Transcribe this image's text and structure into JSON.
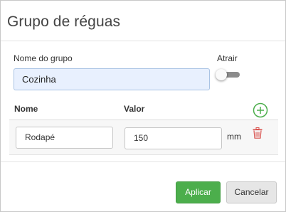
{
  "dialog": {
    "title": "Grupo de réguas"
  },
  "group": {
    "name_label": "Nome do grupo",
    "name_value": "Cozinha",
    "attract_label": "Atrair",
    "attract_enabled": false
  },
  "table": {
    "columns": [
      "Nome",
      "Valor"
    ],
    "rows": [
      {
        "name": "Rodapé",
        "value": "150",
        "unit": "mm"
      }
    ]
  },
  "buttons": {
    "apply_label": "Aplicar",
    "cancel_label": "Cancelar"
  },
  "colors": {
    "accent_green": "#4cae4c",
    "delete_red": "#d9534f",
    "input_highlight": "#e8f0fe"
  },
  "icons": {
    "add": "plus-circle-icon",
    "delete": "trash-icon"
  }
}
